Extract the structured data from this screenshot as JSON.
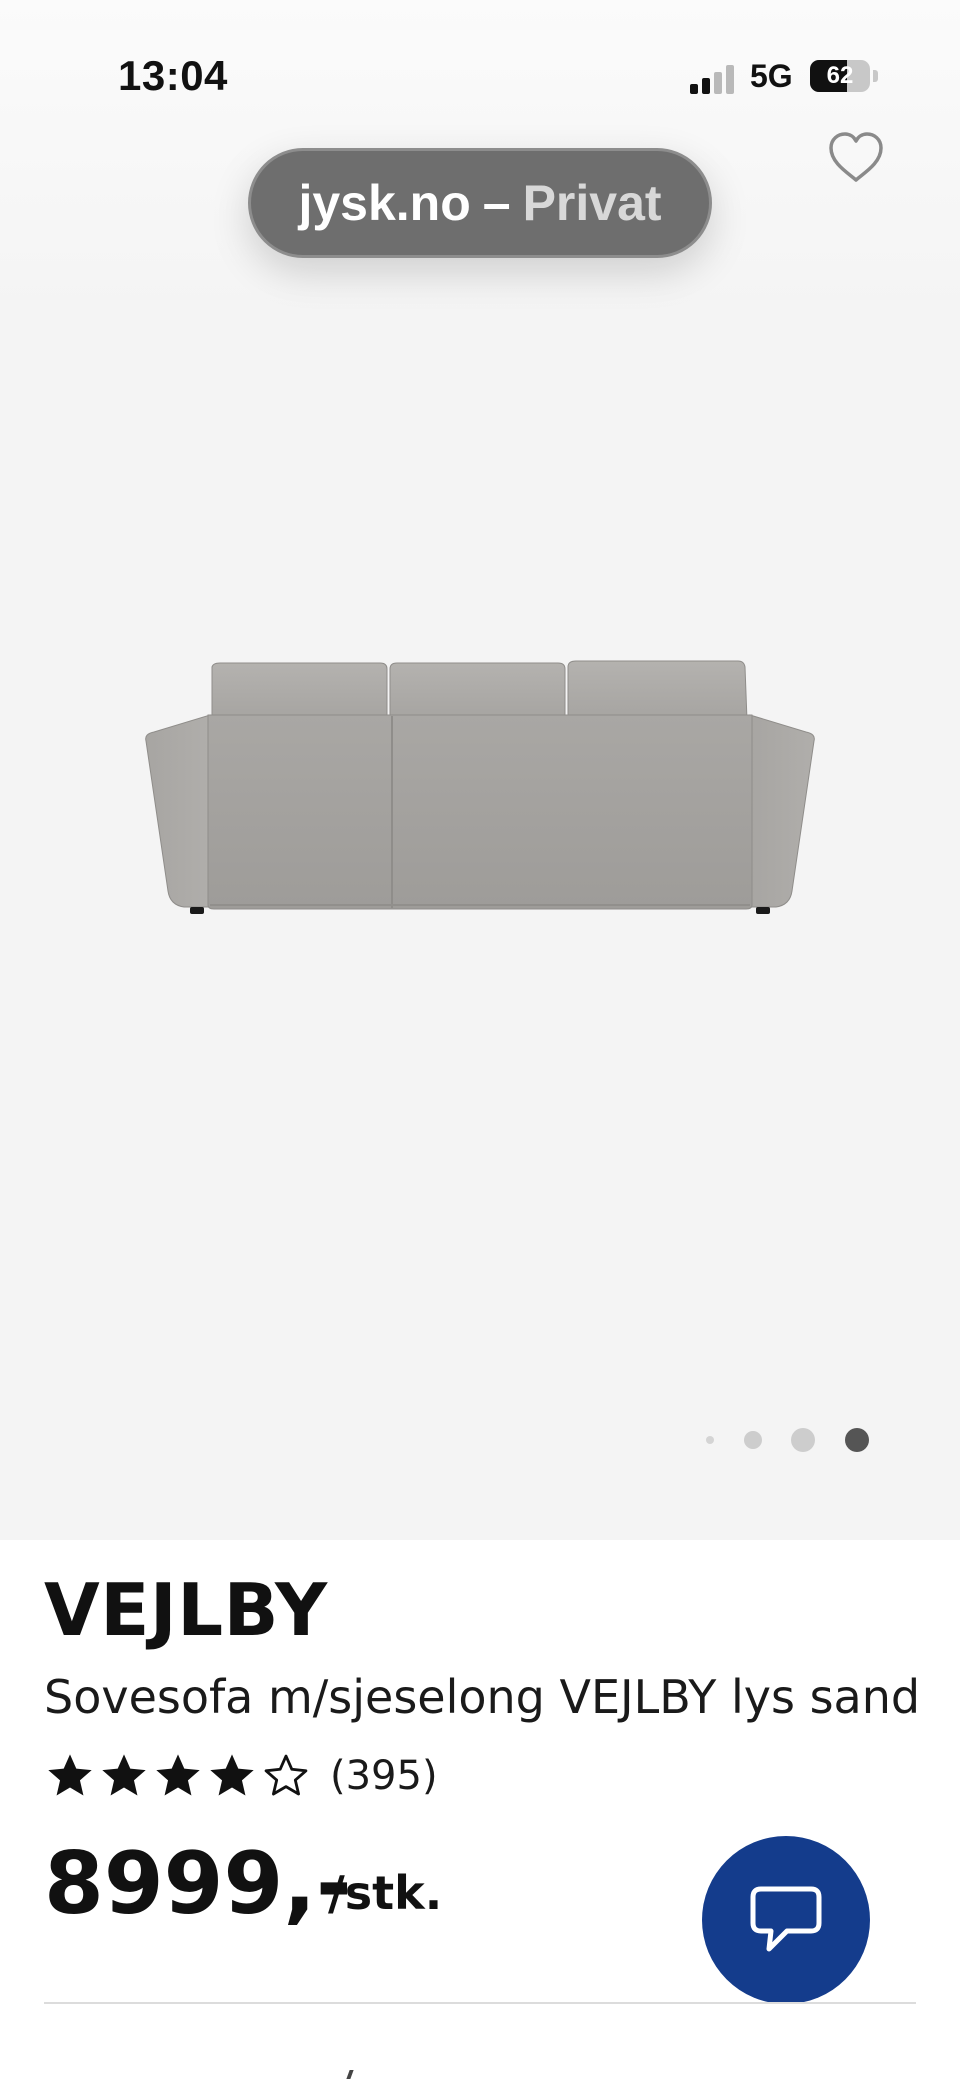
{
  "status_bar": {
    "time": "13:04",
    "network": "5G",
    "battery": "62",
    "battery_level_percent": 62
  },
  "browser": {
    "url_domain": "jysk.no",
    "separator": "–",
    "mode": "Privat"
  },
  "gallery": {
    "image_icon": "sofa-back-view",
    "favourite_icon": "heart-outline-icon",
    "total_images": 4,
    "active_index": 4
  },
  "product": {
    "brand": "VEJLBY",
    "name": "Sovesofa m/sjeselong VEJLBY lys sand",
    "rating_value": 4,
    "rating_max": 5,
    "review_count": "(395)",
    "price": "8999,-",
    "unit": "/stk."
  },
  "chat": {
    "icon": "chat-bubble-icon",
    "color": "#143c8c"
  }
}
